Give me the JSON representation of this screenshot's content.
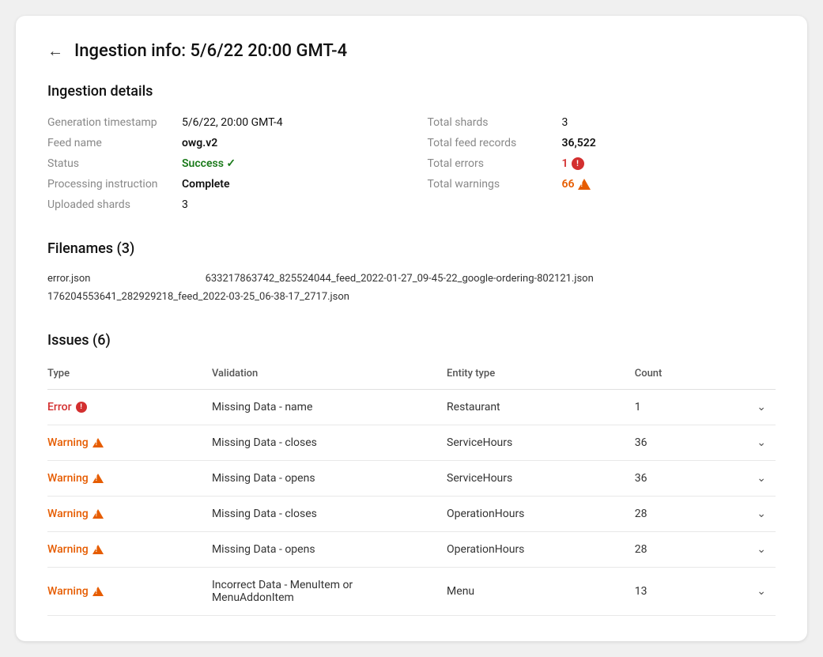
{
  "page": {
    "title": "Ingestion info: 5/6/22 20:00 GMT-4"
  },
  "ingestion_details": {
    "section_title": "Ingestion details",
    "left": [
      {
        "label": "Generation timestamp",
        "value": "5/6/22, 20:00 GMT-4",
        "bold": false
      },
      {
        "label": "Feed name",
        "value": "owg.v2",
        "bold": true
      },
      {
        "label": "Status",
        "value": "Success",
        "type": "success"
      },
      {
        "label": "Processing instruction",
        "value": "Complete",
        "bold": true
      },
      {
        "label": "Uploaded shards",
        "value": "3",
        "bold": false
      }
    ],
    "right": [
      {
        "label": "Total shards",
        "value": "3",
        "bold": false
      },
      {
        "label": "Total feed records",
        "value": "36,522",
        "bold": true
      },
      {
        "label": "Total errors",
        "value": "1",
        "type": "error"
      },
      {
        "label": "Total warnings",
        "value": "66",
        "type": "warning"
      }
    ]
  },
  "filenames": {
    "section_title": "Filenames (3)",
    "files": [
      "error.json",
      "633217863742_825524044_feed_2022-01-27_09-45-22_google-ordering-802121.json",
      "176204553641_282929218_feed_2022-03-25_06-38-17_2717.json"
    ]
  },
  "issues": {
    "section_title": "Issues (6)",
    "columns": [
      "Type",
      "Validation",
      "Entity type",
      "Count"
    ],
    "rows": [
      {
        "type": "Error",
        "type_kind": "error",
        "validation": "Missing Data - name",
        "entity_type": "Restaurant",
        "count": "1"
      },
      {
        "type": "Warning",
        "type_kind": "warning",
        "validation": "Missing Data - closes",
        "entity_type": "ServiceHours",
        "count": "36"
      },
      {
        "type": "Warning",
        "type_kind": "warning",
        "validation": "Missing Data - opens",
        "entity_type": "ServiceHours",
        "count": "36"
      },
      {
        "type": "Warning",
        "type_kind": "warning",
        "validation": "Missing Data - closes",
        "entity_type": "OperationHours",
        "count": "28"
      },
      {
        "type": "Warning",
        "type_kind": "warning",
        "validation": "Missing Data - opens",
        "entity_type": "OperationHours",
        "count": "28"
      },
      {
        "type": "Warning",
        "type_kind": "warning",
        "validation": "Incorrect Data - MenuItem or MenuAddonItem",
        "entity_type": "Menu",
        "count": "13"
      }
    ]
  },
  "icons": {
    "back_arrow": "←",
    "check": "✓",
    "chevron_down": "∨"
  }
}
